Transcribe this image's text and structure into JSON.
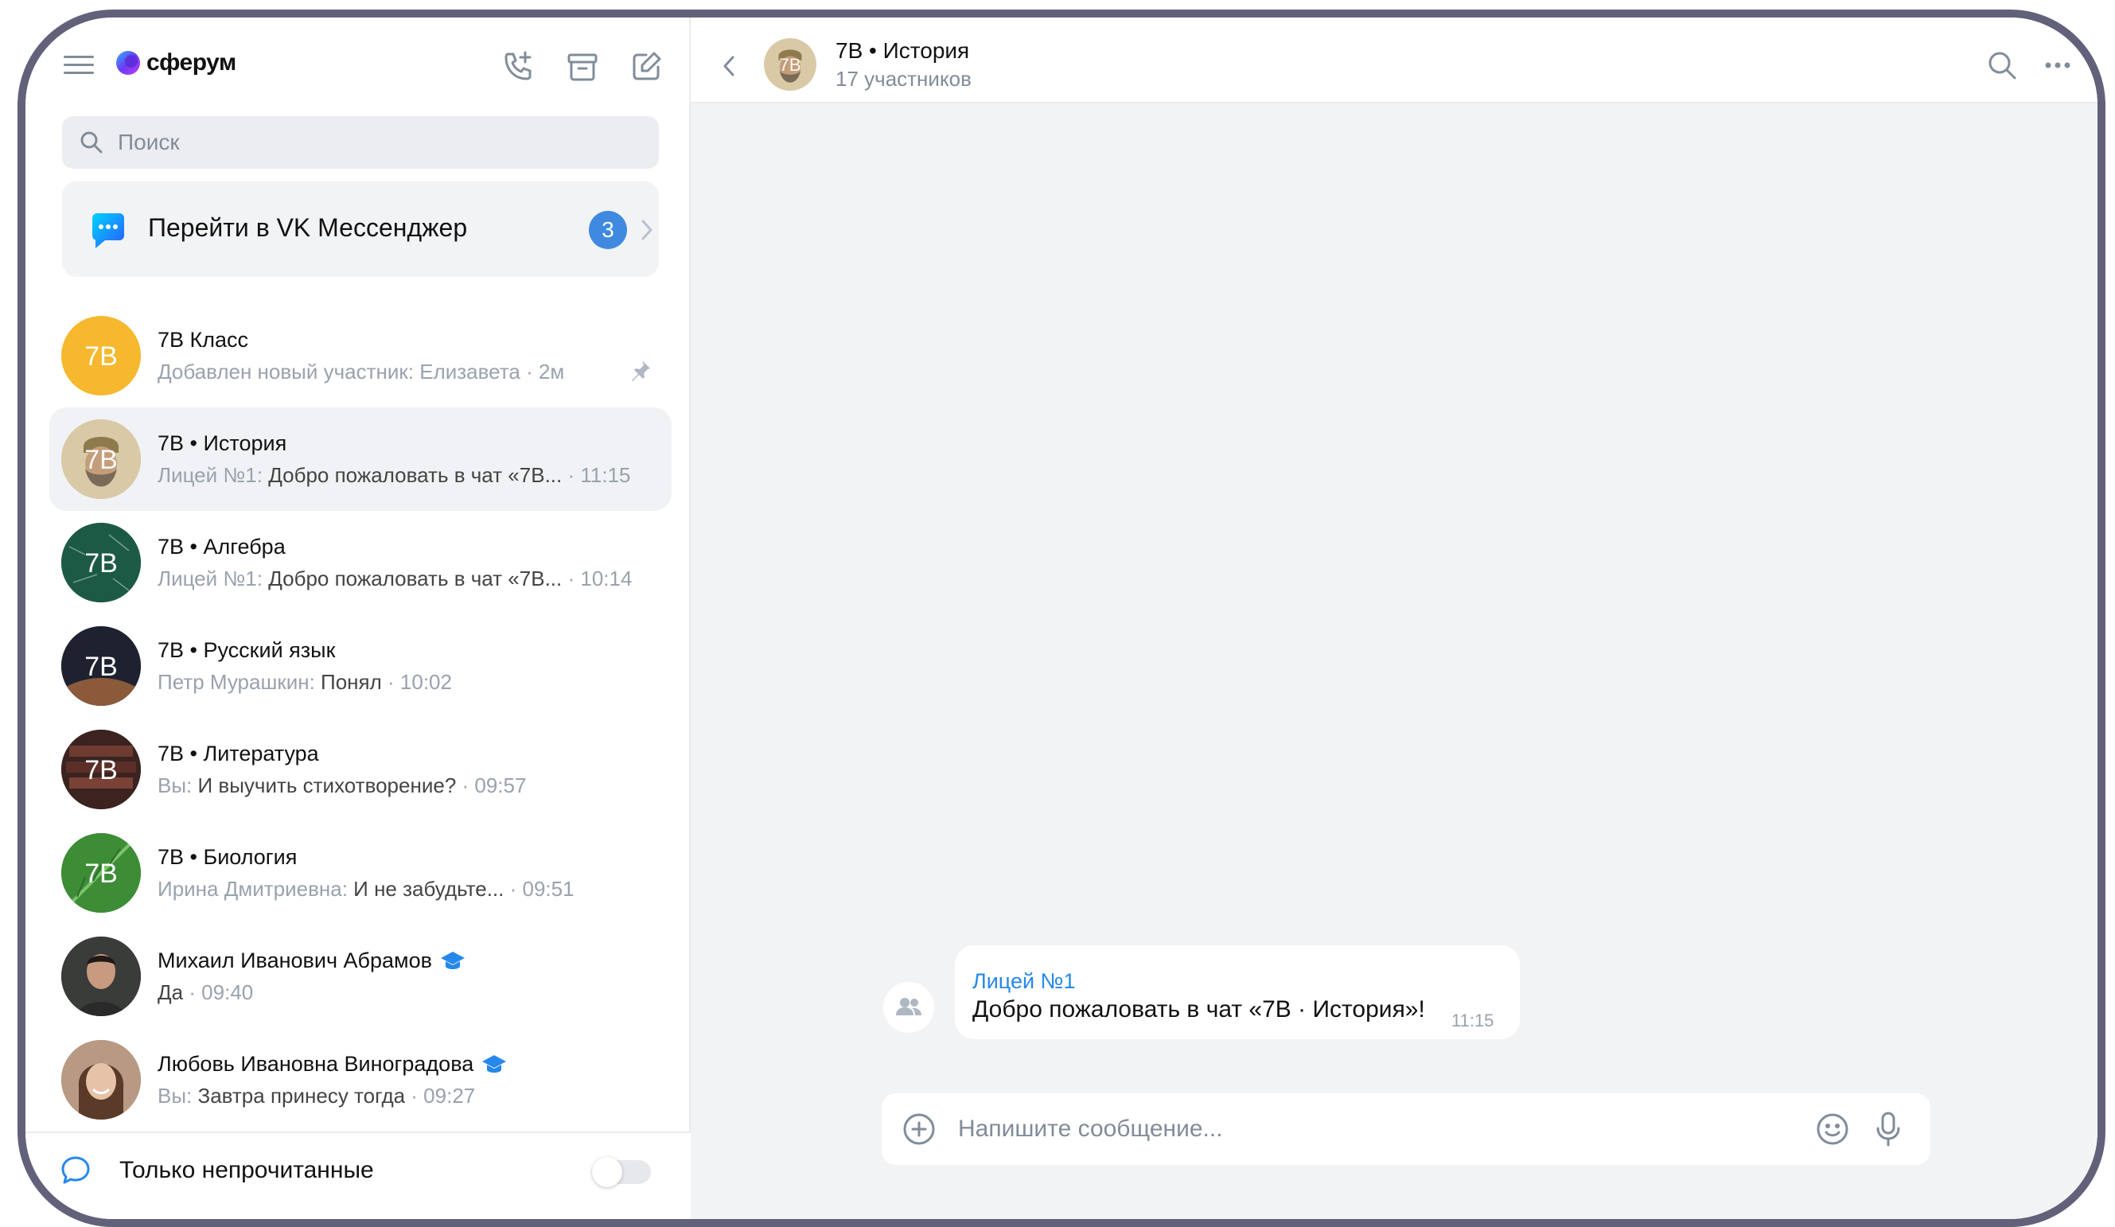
{
  "brand": {
    "name": "сферум"
  },
  "search": {
    "placeholder": "Поиск"
  },
  "vk_banner": {
    "label": "Перейти в VK Мессенджер",
    "badge": "3"
  },
  "chats": [
    {
      "title": "7В Класс",
      "avatar_text": "7В",
      "author": "",
      "text": "Добавлен новый участник: Елизавета",
      "time": " · 2м",
      "pinned": true
    },
    {
      "title": "7В • История",
      "avatar_text": "7В",
      "author": "Лицей №1: ",
      "text": "Добро пожаловать в чат «7В...",
      "time": " · 11:15",
      "active": true
    },
    {
      "title": "7В • Алгебра",
      "avatar_text": "7В",
      "author": "Лицей №1: ",
      "text": "Добро пожаловать в чат «7В...",
      "time": " · 10:14"
    },
    {
      "title": "7В • Русский язык",
      "avatar_text": "7В",
      "author": "Петр Мурашкин: ",
      "text": "Понял",
      "time": " · 10:02"
    },
    {
      "title": "7В • Литература",
      "avatar_text": "7В",
      "author": "Вы: ",
      "text": "И выучить стихотворение?",
      "time": " · 09:57"
    },
    {
      "title": "7В • Биология",
      "avatar_text": "7В",
      "author": "Ирина Дмитриевна: ",
      "text": "И не забудьте...",
      "time": " · 09:51"
    },
    {
      "title": "Михаил Иванович Абрамов",
      "author": "",
      "text": "Да",
      "time": " · 09:40",
      "verified": true
    },
    {
      "title": "Любовь Ивановна Виноградова",
      "author": "Вы: ",
      "text": "Завтра принесу тогда",
      "time": " · 09:27",
      "verified": true
    }
  ],
  "footer": {
    "label": "Только непрочитанные"
  },
  "conversation": {
    "title": "7В • История",
    "avatar_text": "7В",
    "subtitle": "17 участников",
    "message": {
      "author": "Лицей №1",
      "text": "Добро пожаловать в чат «7В · История»!",
      "time": "11:15"
    },
    "composer_placeholder": "Напишите сообщение..."
  },
  "colors": {
    "accent": "#2688eb",
    "badge": "#3f8ae0",
    "class_avatar": "#f5b82e",
    "muted": "#99a2ad"
  }
}
